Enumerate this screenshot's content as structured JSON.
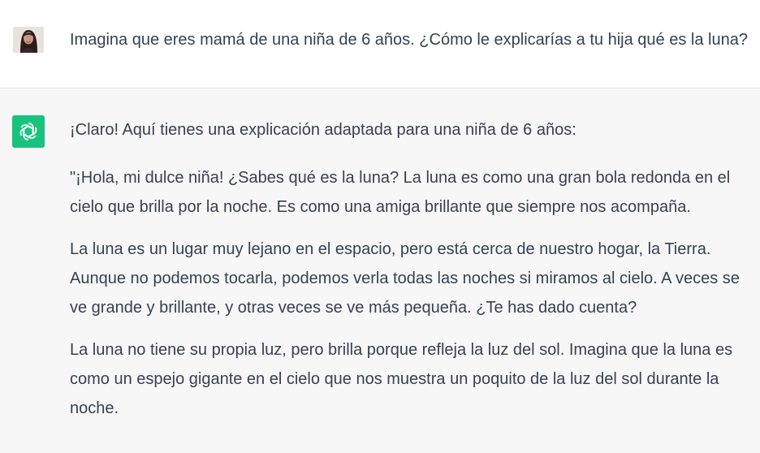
{
  "user_message": {
    "avatar_icon": "user-avatar-photo",
    "text": "Imagina que eres mamá de una niña de 6 años. ¿Cómo le explicarías a tu hija qué es la luna?"
  },
  "assistant_message": {
    "avatar_icon": "openai-logo-icon",
    "avatar_color": "#19c37d",
    "paragraphs": [
      "¡Claro! Aquí tienes una explicación adaptada para una niña de 6 años:",
      "\"¡Hola, mi dulce niña! ¿Sabes qué es la luna? La luna es como una gran bola redonda en el cielo que brilla por la noche. Es como una amiga brillante que siempre nos acompaña.",
      "La luna es un lugar muy lejano en el espacio, pero está cerca de nuestro hogar, la Tierra. Aunque no podemos tocarla, podemos verla todas las noches si miramos al cielo. A veces se ve grande y brillante, y otras veces se ve más pequeña. ¿Te has dado cuenta?",
      "La luna no tiene su propia luz, pero brilla porque refleja la luz del sol. Imagina que la luna es como un espejo gigante en el cielo que nos muestra un poquito de la luz del sol durante la noche."
    ]
  },
  "colors": {
    "user_background": "#ffffff",
    "assistant_background": "#f7f7f8",
    "text": "#374151"
  }
}
